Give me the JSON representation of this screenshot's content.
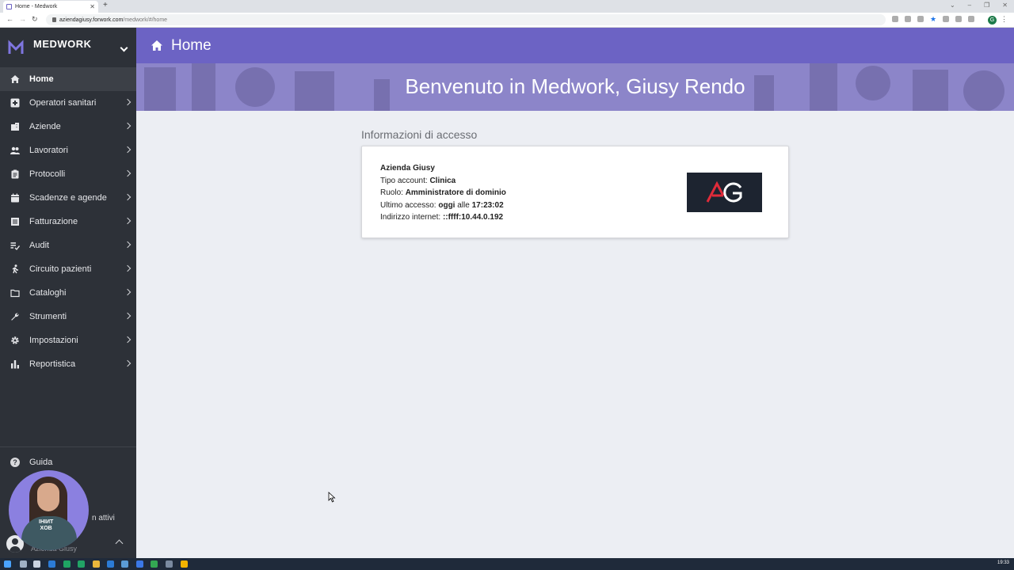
{
  "browser": {
    "tab_title": "Home - Medwork",
    "url_host": "aziendagiusy.forwork.com",
    "url_path": "/medwork/#/home",
    "profile_initial": "G"
  },
  "brand": {
    "name": "MEDWORK"
  },
  "sidebar": {
    "items": [
      {
        "label": "Home",
        "icon": "home-icon",
        "active": true
      },
      {
        "label": "Operatori sanitari",
        "icon": "medical-plus-icon"
      },
      {
        "label": "Aziende",
        "icon": "building-icon"
      },
      {
        "label": "Lavoratori",
        "icon": "people-icon"
      },
      {
        "label": "Protocolli",
        "icon": "clipboard-icon"
      },
      {
        "label": "Scadenze e agende",
        "icon": "calendar-icon"
      },
      {
        "label": "Fatturazione",
        "icon": "invoice-icon"
      },
      {
        "label": "Audit",
        "icon": "checklist-icon"
      },
      {
        "label": "Circuito pazienti",
        "icon": "walking-person-icon"
      },
      {
        "label": "Cataloghi",
        "icon": "folder-icon"
      },
      {
        "label": "Strumenti",
        "icon": "wrench-icon"
      },
      {
        "label": "Impostazioni",
        "icon": "gear-icon"
      },
      {
        "label": "Reportistica",
        "icon": "bar-chart-icon"
      }
    ],
    "guida_label": "Guida",
    "sessions_label": "n attivi",
    "user_sub": "Azienda Giusy"
  },
  "header": {
    "title": "Home"
  },
  "hero": {
    "welcome": "Benvenuto in Medwork, Giusy Rendo"
  },
  "access_info": {
    "section_title": "Informazioni di accesso",
    "company": "Azienda Giusy",
    "account_type_label": "Tipo account:",
    "account_type_value": "Clinica",
    "role_label": "Ruolo:",
    "role_value": "Amministratore di dominio",
    "last_access_label": "Ultimo accesso:",
    "last_access_day": "oggi",
    "last_access_mid": "alle",
    "last_access_time": "17:23:02",
    "ip_label": "Indirizzo internet:",
    "ip_value": "::ffff:10.44.0.192",
    "logo_text": "AG"
  },
  "taskbar": {
    "clock": "19:33"
  },
  "colors": {
    "accent": "#6c63c4",
    "sidebar": "#2d3138",
    "logo_red": "#e02b3a"
  }
}
